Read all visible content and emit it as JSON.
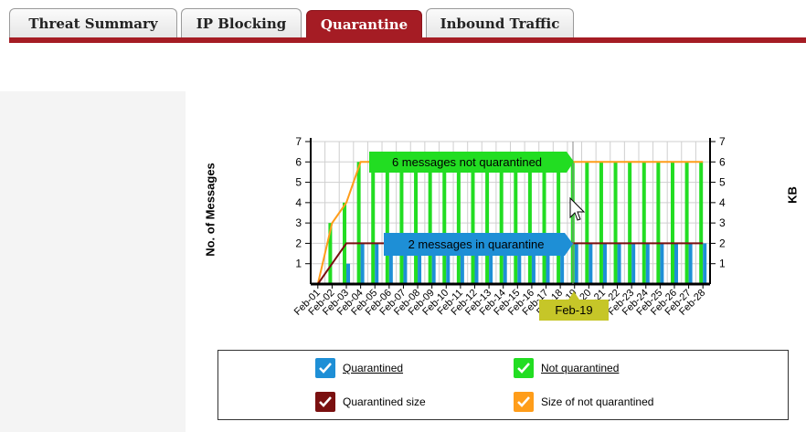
{
  "tabs": [
    {
      "label": "Threat Summary",
      "active": false
    },
    {
      "label": "IP Blocking",
      "active": false
    },
    {
      "label": "Quarantine",
      "active": true
    },
    {
      "label": "Inbound Traffic",
      "active": false
    }
  ],
  "chart": {
    "left_axis_label": "No. of Messages",
    "right_axis_label": "KB",
    "tooltip_not_quarantined": "6 messages not quarantined",
    "tooltip_quarantined": "2 messages in quarantine",
    "tooltip_date": "Feb-19"
  },
  "legend": {
    "quarantined": "Quarantined",
    "not_quarantined": "Not quarantined",
    "quarantined_size": "Quarantined size",
    "size_not_quarantined": "Size of not quarantined"
  },
  "colors": {
    "accent": "#a51c24",
    "quarantined": "#1e8fd6",
    "not_quarantined": "#22dd22",
    "quarantined_size": "#7a1010",
    "size_not_quarantined": "#ff9d1a"
  },
  "chart_data": {
    "type": "bar",
    "categories": [
      "Feb-01",
      "Feb-02",
      "Feb-03",
      "Feb-04",
      "Feb-05",
      "Feb-06",
      "Feb-07",
      "Feb-08",
      "Feb-09",
      "Feb-10",
      "Feb-11",
      "Feb-12",
      "Feb-13",
      "Feb-14",
      "Feb-15",
      "Feb-16",
      "Feb-17",
      "Feb-18",
      "Feb-19",
      "Feb-20",
      "Feb-21",
      "Feb-22",
      "Feb-23",
      "Feb-24",
      "Feb-25",
      "Feb-26",
      "Feb-27",
      "Feb-28"
    ],
    "series": [
      {
        "name": "Quarantined",
        "kind": "bar",
        "values": [
          0,
          0,
          1,
          2,
          2,
          2,
          2,
          2,
          2,
          2,
          2,
          2,
          2,
          2,
          2,
          2,
          2,
          2,
          2,
          2,
          2,
          2,
          2,
          2,
          2,
          2,
          2,
          2
        ]
      },
      {
        "name": "Not quarantined",
        "kind": "bar",
        "values": [
          0,
          3,
          4,
          6,
          6,
          6,
          6,
          6,
          6,
          6,
          6,
          6,
          6,
          6,
          6,
          6,
          6,
          6,
          6,
          6,
          6,
          6,
          6,
          6,
          6,
          6,
          6,
          6
        ]
      },
      {
        "name": "Quarantined size",
        "kind": "line",
        "axis": "right",
        "values": [
          0,
          1,
          2,
          2,
          2,
          2,
          2,
          2,
          2,
          2,
          2,
          2,
          2,
          2,
          2,
          2,
          2,
          2,
          2,
          2,
          2,
          2,
          2,
          2,
          2,
          2,
          2,
          2
        ]
      },
      {
        "name": "Size of not quarantined",
        "kind": "line",
        "axis": "right",
        "values": [
          0,
          3,
          4,
          6,
          6,
          6,
          6,
          6,
          6,
          6,
          6,
          6,
          6,
          6,
          6,
          6,
          6,
          6,
          6,
          6,
          6,
          6,
          6,
          6,
          6,
          6,
          6,
          6
        ]
      }
    ],
    "yticks": [
      1,
      2,
      3,
      4,
      5,
      6,
      7
    ],
    "ylim": [
      0,
      7
    ],
    "ylabel": "No. of Messages",
    "y2label": "KB",
    "grid": true
  }
}
